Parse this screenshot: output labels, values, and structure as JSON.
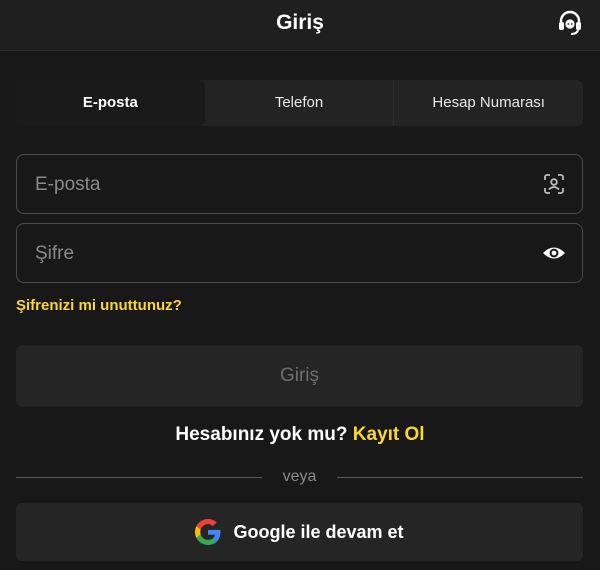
{
  "header": {
    "title": "Giriş",
    "support_icon": "headset-icon"
  },
  "tabs": [
    {
      "label": "E-posta",
      "active": true
    },
    {
      "label": "Telefon",
      "active": false
    },
    {
      "label": "Hesap Numarası",
      "active": false
    }
  ],
  "form": {
    "email": {
      "placeholder": "E-posta",
      "value": "",
      "icon": "face-scan-icon"
    },
    "password": {
      "placeholder": "Şifre",
      "value": "",
      "icon": "eye-icon"
    },
    "forgot_label": "Şifrenizi mi unuttunuz?",
    "submit_label": "Giriş"
  },
  "register": {
    "prompt": "Hesabınız yok mu?",
    "link_label": "Kayıt Ol"
  },
  "divider_text": "veya",
  "google": {
    "label": "Google ile devam et",
    "icon": "google-icon"
  },
  "colors": {
    "accent": "#fcd535",
    "background": "#181818",
    "surface": "#252525"
  }
}
